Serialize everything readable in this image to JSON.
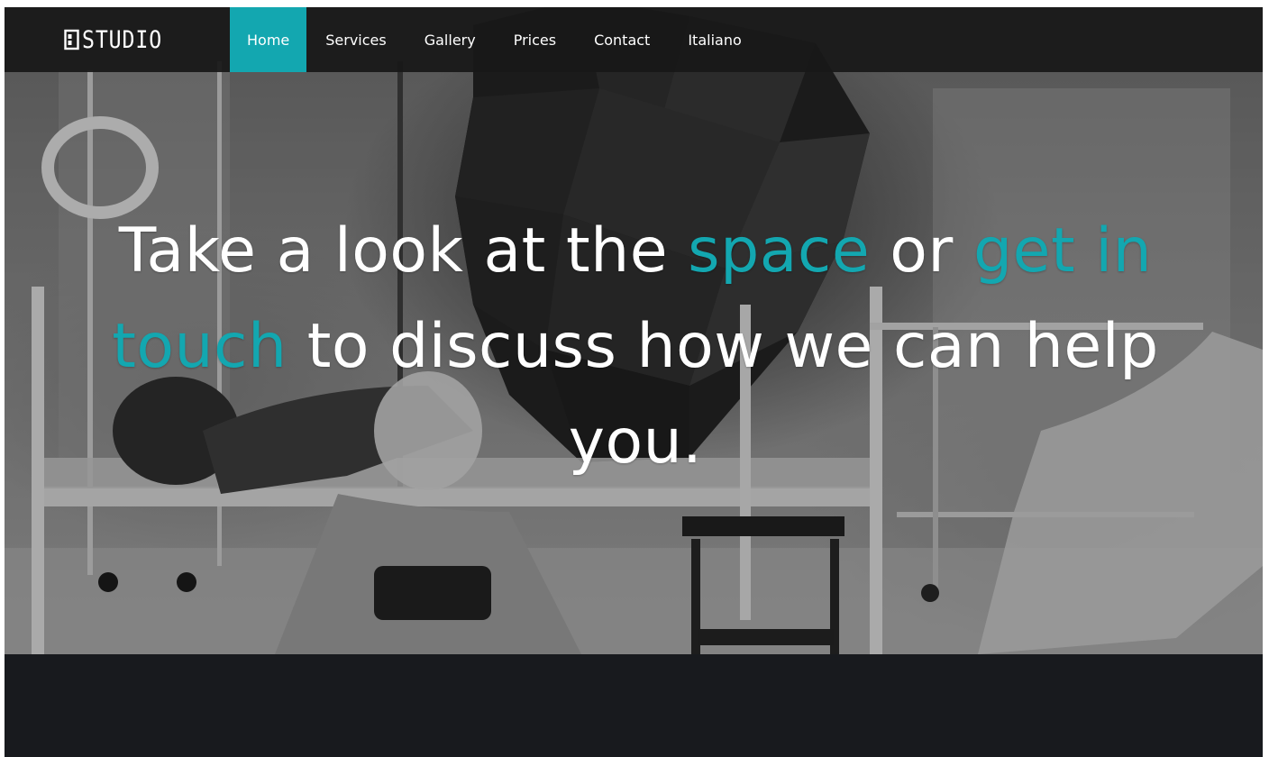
{
  "brand": {
    "name": "STUDIO",
    "logo_icon": "studio-logo-mark-icon"
  },
  "nav": {
    "items": [
      {
        "label": "Home",
        "active": true
      },
      {
        "label": "Services",
        "active": false
      },
      {
        "label": "Gallery",
        "active": false
      },
      {
        "label": "Prices",
        "active": false
      },
      {
        "label": "Contact",
        "active": false
      },
      {
        "label": "Italiano",
        "active": false
      }
    ]
  },
  "hero": {
    "headline": {
      "part1": "Take a look at the ",
      "accent1": "space",
      "part2": " or ",
      "accent2": "get in touch",
      "part3": " to discuss how we can help you."
    }
  },
  "colors": {
    "accent": "#13a7b0",
    "navbar": "#181818",
    "footer_bg": "#181a1e",
    "text": "#ffffff"
  }
}
